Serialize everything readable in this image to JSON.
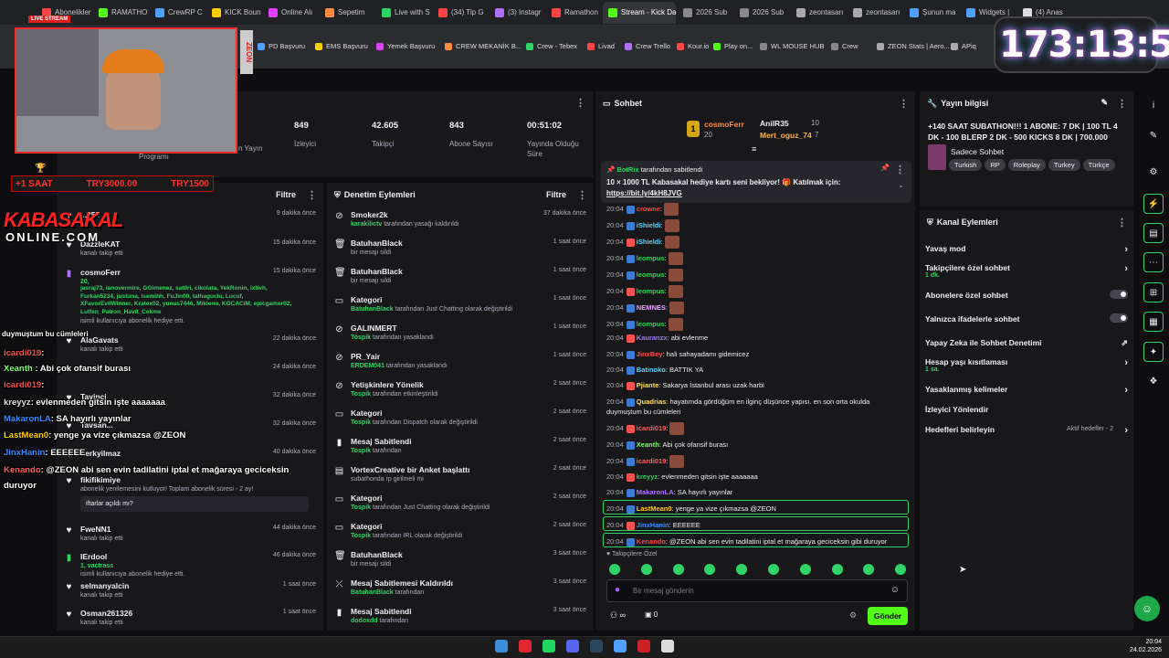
{
  "browser": {
    "tabs": [
      "Abonelikler",
      "RAMATHO",
      "CrewRP C",
      "KICK Boun",
      "Online Alı",
      "Sepetim",
      "Live with S",
      "(34) Tip G",
      "(3) Instagr",
      "Ramathon",
      "Stream - Kick Dash",
      "2026 Sub",
      "2026 Sub",
      "zeontasarı",
      "zeontasarı",
      "Şunun ma",
      "Widgets |",
      "(4) Anas"
    ],
    "bookmarks": [
      "PD Başvuru",
      "EMS Başvuru",
      "Yemek Başvuru",
      "CREW MEKANİK B...",
      "Crew - Tebex",
      "Livad",
      "Crew Trello",
      "Kour.io",
      "Play on...",
      "WL MOUSE HUB",
      "Crew",
      "ZEON Stats | Aero...",
      "APiq"
    ]
  },
  "overlay": {
    "timer": "173:13:50",
    "live_badge": "LIVE STREAM",
    "promo": [
      "+1 SAAT",
      "TRY3000.00",
      "TRY1500"
    ],
    "logo_top": "KABASAKAL",
    "logo_bottom": "ONLINE.COM",
    "zeon": "ZEON",
    "chat": [
      {
        "name": "icardi019",
        "text": ": ",
        "color": "#ff4d4d"
      },
      {
        "name": "Xeanth",
        "text": " :  Abi çok ofansif burası",
        "color": "#7dff6a"
      },
      {
        "name": "icardi019",
        "text": ": ",
        "color": "#ff4d4d"
      },
      {
        "name": "kreyyz",
        "text": ": evlenmeden gitsin işte aaaaaaa",
        "color": "#e0e0e0"
      },
      {
        "name": "MakaronLA",
        "text": ": SA hayırlı yayınlar",
        "color": "#2f8fff"
      },
      {
        "name": "LastMean0",
        "text": ": yenge ya vize çıkmazsa @ZEON",
        "color": "#ffcc00"
      },
      {
        "name": "JinxHanin",
        "text": ": EEEEEE",
        "color": "#2f8fff"
      },
      {
        "name": "Kenando",
        "text": ": @ZEON abi sen evin tadilatini iptal et mağaraya geciceksin",
        "color": "#ff5a5a"
      },
      {
        "name": "",
        "text": "duruyor",
        "color": "#fff"
      }
    ],
    "chat_top": "duymuştum bu cümleleri"
  },
  "stats": [
    {
      "value": "849",
      "label": "İzleyici"
    },
    {
      "value": "42.605",
      "label": "Takipçi"
    },
    {
      "value": "843",
      "label": "Abone Sayısı"
    },
    {
      "value": "00:51:02",
      "label": "Yayında Olduğu Süre"
    }
  ],
  "stats_partial": {
    "a": "n Yayın",
    "b": "Programı"
  },
  "activity": {
    "filter": "Filtre",
    "items": [
      {
        "name": "...255",
        "sub": "",
        "time": "9 dakika önce"
      },
      {
        "name": "DazzleKAT",
        "sub": "kanalı takip etti",
        "time": "15 dakika önce"
      },
      {
        "name": "cosmoFerr",
        "sub": "isimli kullanıcıya abonelik hediye etti.",
        "time": "15 dakika önce",
        "count": "20,",
        "list": "jasraj73, ianovermire, GGimenez, sat0ri, cikolata, YekRonin, ixtivh, Furkan5234, justuna, isemihh, FuJin00, talhaguclu, Lucuf, XFavorEvilWinner, Kratex02, yunus7446, Mikieno, KOCACIM, epicgamer02, Lutfen_Patron_Havit_Cekme"
      },
      {
        "name": "AlaGavats",
        "sub": "kanalı takip etti",
        "time": "22 dakika önce"
      },
      {
        "name": "K...",
        "sub": "",
        "time": "24 dakika önce"
      },
      {
        "name": "Tayinci",
        "sub": "",
        "time": "32 dakika önce"
      },
      {
        "name": "Tavsan...",
        "sub": "",
        "time": "32 dakika önce"
      },
      {
        "name": "berkyilmaz",
        "sub": "",
        "time": "40 dakika önce"
      },
      {
        "name": "fikifikimiye",
        "sub": "abonelik yenilemesini kutluyor! Toplam abonelik süresi - 2 ay!",
        "time": "",
        "quote": "iftarlar açıldı mı?"
      },
      {
        "name": "FweNN1",
        "sub": "kanalı takip etti",
        "time": "44 dakika önce"
      },
      {
        "name": "IErdool",
        "sub": "isimli kullanıcıya abonelik hediye etti.",
        "time": "46 dakika önce",
        "count": "1, vactrass"
      },
      {
        "name": "selmanyalcin",
        "sub": "kanalı takip etti",
        "time": "1 saat önce"
      },
      {
        "name": "Osman261326",
        "sub": "kanalı takip etti",
        "time": "1 saat önce"
      }
    ]
  },
  "mod": {
    "title": "Denetim Eylemleri",
    "filter": "Filtre",
    "items": [
      {
        "name": "Smoker2k",
        "by": "karakilictv",
        "sub": "tarafından yasağı kaldırıldı",
        "time": "37 dakika önce"
      },
      {
        "name": "BatuhanBlack",
        "by": "",
        "sub": "bir mesajı sildi",
        "time": "1 saat önce"
      },
      {
        "name": "BatuhanBlack",
        "by": "",
        "sub": "bir mesajı sildi",
        "time": "1 saat önce"
      },
      {
        "name": "Kategori",
        "by": "BatuhanBlack",
        "sub": "tarafından Just Chatting olarak değiştirildi",
        "time": "1 saat önce"
      },
      {
        "name": "GALINMERT",
        "by": "Tospik",
        "sub": "tarafından yasaklandı",
        "time": "1 saat önce"
      },
      {
        "name": "PR_Yair",
        "by": "ERDEM041",
        "sub": "tarafından yasaklandı",
        "time": "1 saat önce"
      },
      {
        "name": "Yetişkinlere Yönelik",
        "by": "Tospik",
        "sub": "tarafından etkinleştirildi",
        "time": "2 saat önce"
      },
      {
        "name": "Kategori",
        "by": "Tospik",
        "sub": "tarafından Dispatch olarak değiştirildi",
        "time": "2 saat önce"
      },
      {
        "name": "Mesaj Sabitlendi",
        "by": "Tospik",
        "sub": "tarafından",
        "time": "2 saat önce"
      },
      {
        "name": "VortexCreative bir Anket başlattı",
        "by": "",
        "sub": "subathonda rp girilmeli mi",
        "time": "2 saat önce"
      },
      {
        "name": "Kategori",
        "by": "Tospik",
        "sub": "tarafından Just Chatting olarak değiştirildi",
        "time": "2 saat önce"
      },
      {
        "name": "Kategori",
        "by": "Tospik",
        "sub": "tarafından IRL olarak değiştirildi",
        "time": "2 saat önce"
      },
      {
        "name": "BatuhanBlack",
        "by": "",
        "sub": "bir mesajı sildi",
        "time": "3 saat önce"
      },
      {
        "name": "Mesaj Sabitlemesi Kaldırıldı",
        "by": "BatuhanBlack",
        "sub": "tarafından",
        "time": "3 saat önce"
      },
      {
        "name": "Mesaj Sabitlendi",
        "by": "dodoxdd",
        "sub": "tarafından",
        "time": "3 saat önce"
      }
    ]
  },
  "chat": {
    "title": "Sohbet",
    "top1": "cosmoFerr",
    "top1n": "20",
    "top2": "AnilR35",
    "top2n": "10",
    "top3": "Mert_oguz_74",
    "top3n": "7",
    "pinned_by": "BotRix",
    "pinned_sub": "tarafından sabitlendi",
    "pinned_text": "10 × 1000 TL Kabasakal hediye kartı seni bekliyor! 🎁 Katılmak için:",
    "pinned_link": "https://bit.ly/4kH8JVG",
    "messages": [
      {
        "t": "20:04",
        "u": "amuhaze",
        "m": ": ohooooooooooooo",
        "c": "#8a70ff"
      },
      {
        "t": "20:04",
        "u": "crowne",
        "m": ":",
        "c": "#ff4040"
      },
      {
        "t": "20:04",
        "u": "iShieldi",
        "m": ":",
        "c": "#52d9ff"
      },
      {
        "t": "20:04",
        "u": "iShieldi",
        "m": ":",
        "c": "#52d9ff"
      },
      {
        "t": "20:04",
        "u": "leompus",
        "m": ":",
        "c": "#34d058"
      },
      {
        "t": "20:04",
        "u": "leompus",
        "m": ":",
        "c": "#34d058"
      },
      {
        "t": "20:04",
        "u": "leompus",
        "m": ":",
        "c": "#34d058"
      },
      {
        "t": "20:04",
        "u": "NEMNES",
        "m": ":",
        "c": "#e8a0ff"
      },
      {
        "t": "20:04",
        "u": "leompus",
        "m": ":",
        "c": "#34d058"
      },
      {
        "t": "20:04",
        "u": "Kauranzx",
        "m": ": abi evlenme",
        "c": "#9d7bff"
      },
      {
        "t": "20:04",
        "u": "JinxBey",
        "m": ": hali sahayadamı gidemicez",
        "c": "#ff4d4d"
      },
      {
        "t": "20:04",
        "u": "Batinoko",
        "m": ": BATTIK YA",
        "c": "#52d9ff"
      },
      {
        "t": "20:04",
        "u": "Pjiante",
        "m": ": Sakarya İstanbul arası uzak harbi",
        "c": "#ffe066"
      },
      {
        "t": "20:04",
        "u": "Quadrias",
        "m": ": hayatımda gördüğüm en ilginç düşünce yapısı. en son orta okulda",
        "c": "#ffe066"
      },
      {
        "t": "",
        "u": "",
        "m": "duymuştum bu cümleleri",
        "c": "#fff"
      },
      {
        "t": "20:04",
        "u": "icardi019",
        "m": ":",
        "c": "#ff6060"
      },
      {
        "t": "20:04",
        "u": "Xeanth",
        "m": ": Abi çok ofansif burası",
        "c": "#7dff6a"
      },
      {
        "t": "20:04",
        "u": "icardi019",
        "m": ":",
        "c": "#ff6060"
      },
      {
        "t": "20:04",
        "u": "kreyyz",
        "m": ": evlenmeden gitsin işte aaaaaaa",
        "c": "#34d058"
      },
      {
        "t": "20:04",
        "u": "MakaronLA",
        "m": ": SA hayırlı yayınlar",
        "c": "#b070ff"
      },
      {
        "t": "20:04",
        "u": "LastMean0",
        "m": ": yenge ya vize çıkmazsa @ZEON",
        "c": "#ffcc00"
      },
      {
        "t": "20:04",
        "u": "JinxHanin",
        "m": ": EEEEEE",
        "c": "#2f8fff"
      },
      {
        "t": "20:04",
        "u": "Kenando",
        "m": ": @ZEON abi sen evin tadilatini iptal et mağaraya geciceksin gibi duruyor",
        "c": "#ff4040"
      }
    ],
    "followers_only": "Takipçilere Özel",
    "placeholder": "Bir mesaj gönderin",
    "send": "Gönder",
    "points": "0"
  },
  "info": {
    "title": "Yayın bilgisi",
    "desc": "+140 SAAT SUBATHON!!! 1 ABONE: 7 DK | 100 TL 4 DK - 100 BLERP 2 DK - 500 KICKS 8 DK | 700.000 TL...",
    "category": "Sadece Sohbet",
    "tags": [
      "Turkish",
      "RP",
      "Roleplay",
      "Turkey",
      "Türkçe"
    ]
  },
  "channel": {
    "title": "Kanal Eylemleri",
    "items": [
      {
        "label": "Yavaş mod",
        "sub": "",
        "ctl": "chev"
      },
      {
        "label": "Takipçilere özel sohbet",
        "sub": "1 dk.",
        "ctl": "chev"
      },
      {
        "label": "Abonelere özel sohbet",
        "sub": "",
        "ctl": "toggle"
      },
      {
        "label": "Yalnızca ifadelerle sohbet",
        "sub": "",
        "ctl": "toggle"
      },
      {
        "label": "Yapay Zeka ile Sohbet Denetimi",
        "sub": "",
        "ctl": "ext"
      },
      {
        "label": "Hesap yaşı kısıtlaması",
        "sub": "1 sa.",
        "ctl": "chev"
      },
      {
        "label": "Yasaklanmış kelimeler",
        "sub": "",
        "ctl": "chev"
      },
      {
        "label": "İzleyici Yönlendir",
        "sub": "",
        "ctl": ""
      },
      {
        "label": "Hedefleri belirleyin",
        "sub": "",
        "ctl": "chev",
        "extra": "Aktif hedefler - 2"
      }
    ]
  },
  "taskbar": {
    "time": "20:04",
    "date": "24.02.2026"
  }
}
